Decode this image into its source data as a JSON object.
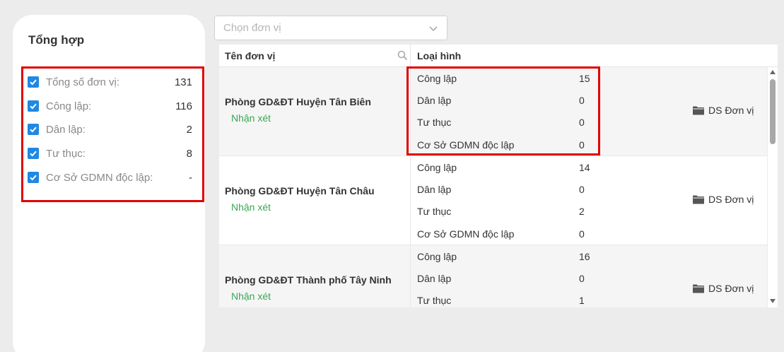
{
  "summary": {
    "title": "Tổng hợp",
    "items": [
      {
        "label": "Tổng số đơn vị:",
        "value": "131",
        "checked": true
      },
      {
        "label": "Công lập:",
        "value": "116",
        "checked": true
      },
      {
        "label": "Dân lập:",
        "value": "2",
        "checked": true
      },
      {
        "label": "Tư thục:",
        "value": "8",
        "checked": true
      },
      {
        "label": "Cơ Sở GDMN độc lập:",
        "value": "-",
        "checked": true
      }
    ]
  },
  "unit_select": {
    "placeholder": "Chọn đơn vị"
  },
  "table": {
    "headers": {
      "name": "Tên đơn vị",
      "type": "Loại hình"
    },
    "rows": [
      {
        "name": "Phòng GD&ĐT Huyện Tân Biên",
        "comment": "Nhận xét",
        "types": [
          {
            "label": "Công lập",
            "value": "15"
          },
          {
            "label": "Dân lập",
            "value": "0"
          },
          {
            "label": "Tư thục",
            "value": "0"
          },
          {
            "label": "Cơ Sở GDMN độc lập",
            "value": "0"
          }
        ],
        "action": "DS Đơn vị"
      },
      {
        "name": "Phòng GD&ĐT Huyện Tân Châu",
        "comment": "Nhận xét",
        "types": [
          {
            "label": "Công lập",
            "value": "14"
          },
          {
            "label": "Dân lập",
            "value": "0"
          },
          {
            "label": "Tư thục",
            "value": "2"
          },
          {
            "label": "Cơ Sở GDMN độc lập",
            "value": "0"
          }
        ],
        "action": "DS Đơn vị"
      },
      {
        "name": "Phòng GD&ĐT Thành phố Tây Ninh",
        "comment": "Nhận xét",
        "types": [
          {
            "label": "Công lập",
            "value": "16"
          },
          {
            "label": "Dân lập",
            "value": "0"
          },
          {
            "label": "Tư thục",
            "value": "1"
          },
          {
            "label": "",
            "value": ""
          }
        ],
        "action": "DS Đơn vị"
      }
    ]
  },
  "colors": {
    "checkbox": "#1e88e5",
    "link_green": "#3aa655",
    "highlight_red": "#e00000"
  },
  "icons": [
    "check-icon",
    "chevron-down-icon",
    "search-icon",
    "folder-icon",
    "scroll-up-icon",
    "scroll-down-icon"
  ]
}
